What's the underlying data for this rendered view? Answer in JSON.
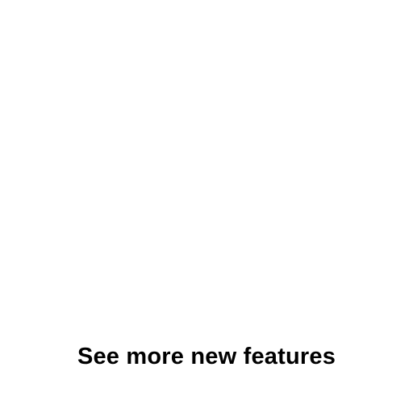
{
  "main": {
    "cta_label": "See more new features",
    "text_color": "#000000",
    "background_color": "#ffffff"
  }
}
